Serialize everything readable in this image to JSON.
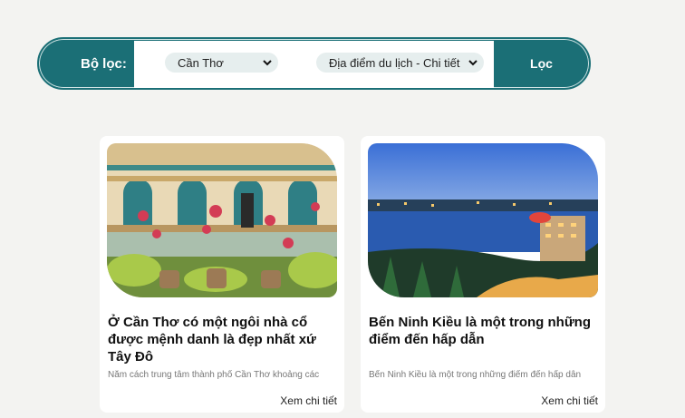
{
  "filter": {
    "label": "Bộ lọc:",
    "city_select": "Cần Thơ",
    "category_select": "Địa điểm du lịch - Chi tiết",
    "button": "Lọc"
  },
  "cards": [
    {
      "title": "Ở Cần Thơ có một ngôi nhà cổ được mệnh danh là đẹp nhất xứ Tây Đô",
      "description": "Nằm cách trung tâm thành phố Cần Thơ khoảng các",
      "link": "Xem chi tiết"
    },
    {
      "title": "Bến Ninh Kiều là một trong những điểm đến hấp dẫn",
      "description": "Bến Ninh Kiều là một trong những điểm đến hấp dẫn",
      "link": "Xem chi tiết"
    }
  ],
  "colors": {
    "teal": "#1b6f76",
    "background": "#f3f3f1"
  }
}
